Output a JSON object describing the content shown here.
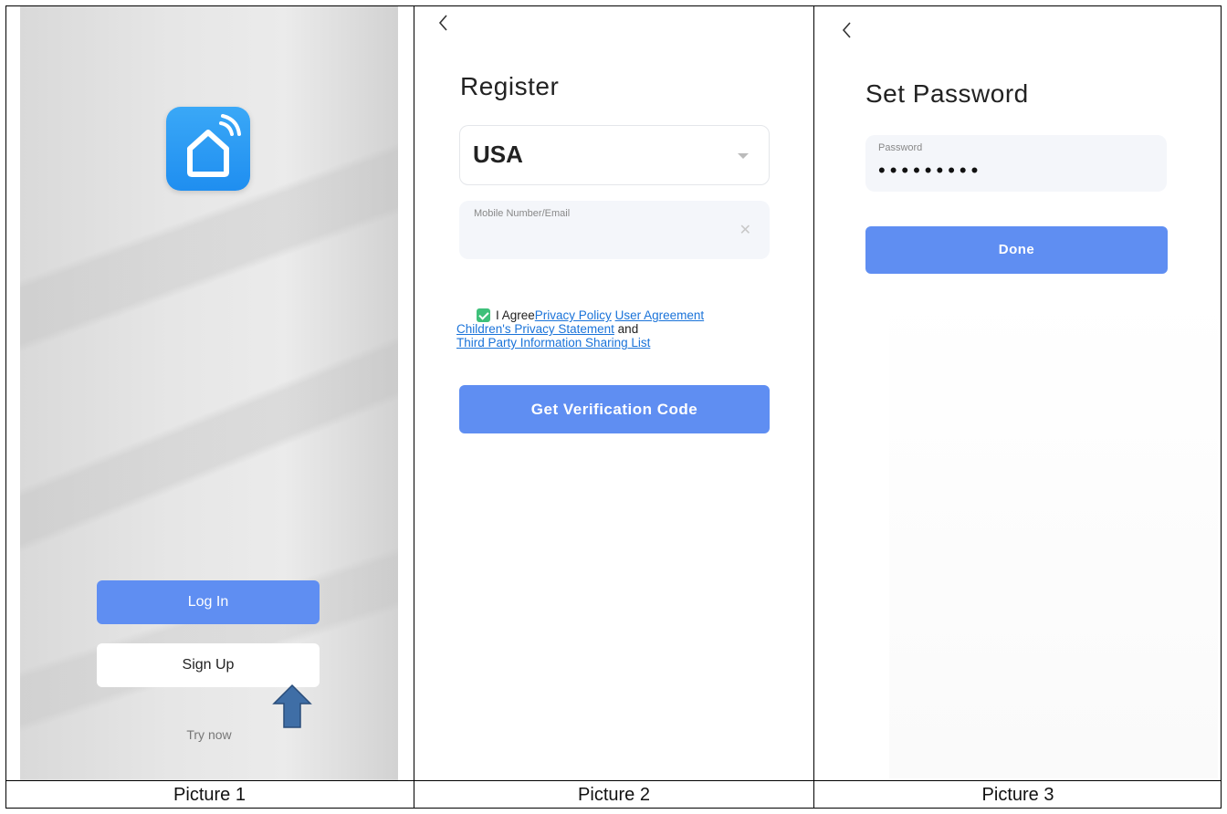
{
  "panel1": {
    "login_label": "Log In",
    "signup_label": "Sign Up",
    "try_now_label": "Try now",
    "brand_color": "#5f8ef2",
    "icons": [
      "smart-home-app-icon",
      "arrow-up-icon"
    ]
  },
  "panel2": {
    "title": "Register",
    "country_value": "USA",
    "mobile_label": "Mobile Number/Email",
    "mobile_value": "",
    "agree_prefix": "I Agree",
    "privacy_policy": "Privacy Policy",
    "user_agreement": "User Agreement",
    "childrens_privacy": "Children's Privacy Statement",
    "and_text": "and",
    "third_party": "Third Party Information Sharing List",
    "agree_checked": true,
    "verify_button": "Get Verification Code",
    "icons": [
      "back-chevron-icon",
      "dropdown-caret-icon",
      "clear-icon",
      "checkbox-checked-icon"
    ]
  },
  "panel3": {
    "title": "Set Password",
    "password_label": "Password",
    "password_mask": "•••••••••",
    "done_button": "Done",
    "icons": [
      "back-chevron-icon"
    ]
  },
  "captions": [
    "Picture 1",
    "Picture 2",
    "Picture 3"
  ]
}
